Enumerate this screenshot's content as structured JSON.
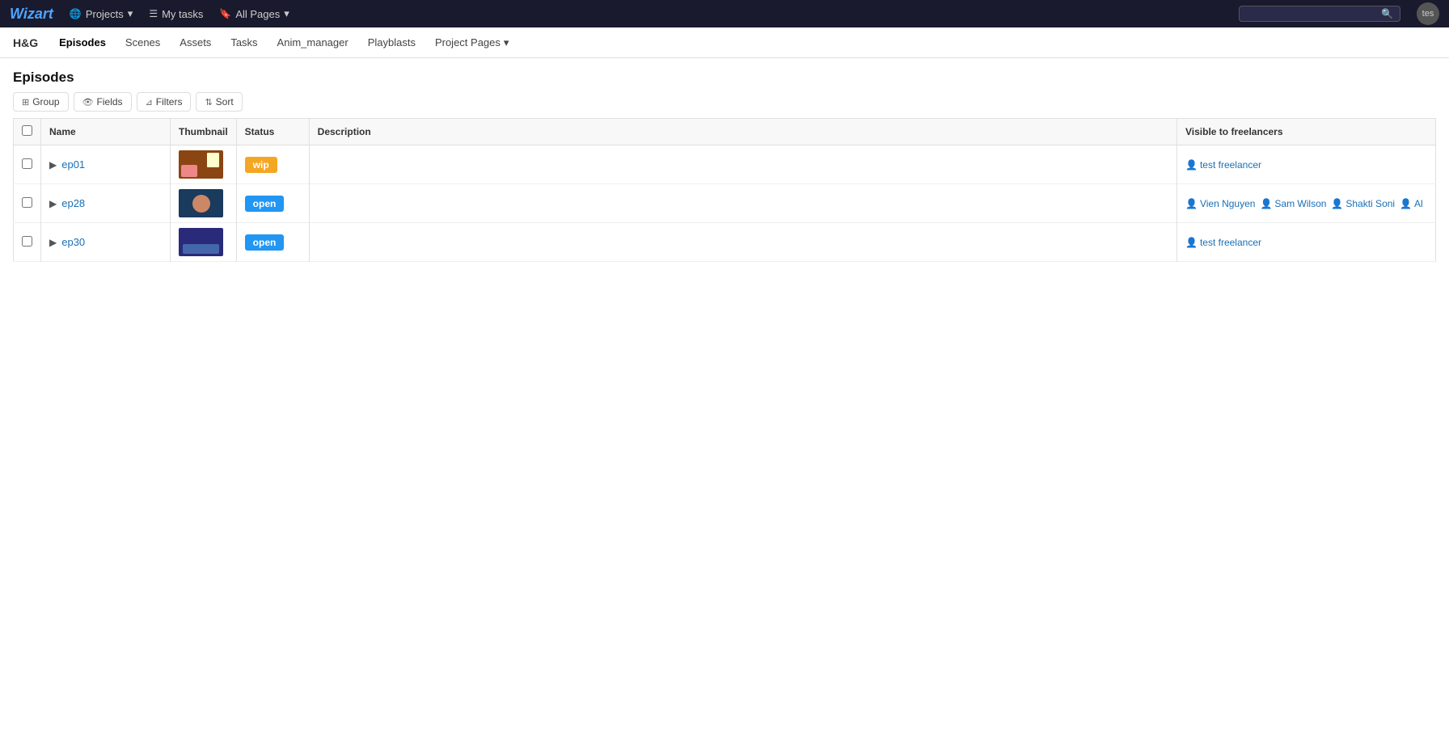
{
  "app": {
    "logo_text": "izart",
    "logo_prefix": "W"
  },
  "top_nav": {
    "projects_label": "Projects",
    "my_tasks_label": "My tasks",
    "all_pages_label": "All Pages",
    "search_placeholder": "",
    "avatar_text": "tes"
  },
  "sec_nav": {
    "project_label": "H&G",
    "items": [
      {
        "label": "Episodes",
        "active": true
      },
      {
        "label": "Scenes",
        "active": false
      },
      {
        "label": "Assets",
        "active": false
      },
      {
        "label": "Tasks",
        "active": false
      },
      {
        "label": "Anim_manager",
        "active": false
      },
      {
        "label": "Playblasts",
        "active": false
      },
      {
        "label": "Project Pages",
        "active": false,
        "has_arrow": true
      }
    ]
  },
  "page": {
    "title": "Episodes"
  },
  "toolbar": {
    "group_label": "Group",
    "fields_label": "Fields",
    "filters_label": "Filters",
    "sort_label": "Sort"
  },
  "table": {
    "columns": [
      "Name",
      "Thumbnail",
      "Status",
      "Description",
      "Visible to freelancers"
    ],
    "rows": [
      {
        "name": "ep01",
        "status": "wip",
        "status_class": "status-wip",
        "description": "",
        "freelancers": [
          {
            "name": "test freelancer"
          }
        ],
        "thumbnail_bg": "#a0522d"
      },
      {
        "name": "ep28",
        "status": "open",
        "status_class": "status-open",
        "description": "",
        "freelancers": [
          {
            "name": "Vien Nguyen"
          },
          {
            "name": "Sam Wilson"
          },
          {
            "name": "Shakti Soni"
          },
          {
            "name": "Al"
          }
        ],
        "thumbnail_bg": "#2c4a6e"
      },
      {
        "name": "ep30",
        "status": "open",
        "status_class": "status-open",
        "description": "",
        "freelancers": [
          {
            "name": "test freelancer"
          }
        ],
        "thumbnail_bg": "#3a3a8a"
      }
    ]
  }
}
